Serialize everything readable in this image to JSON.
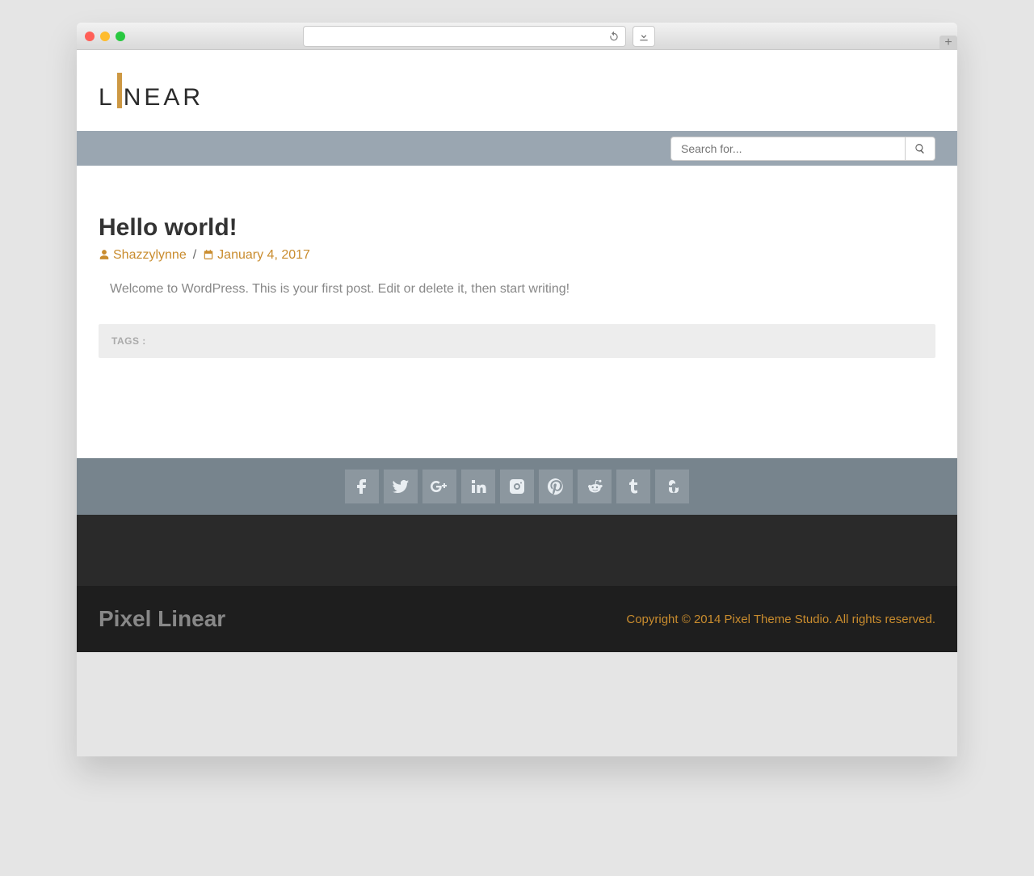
{
  "browser": {
    "address_value": "",
    "new_tab_glyph": "+"
  },
  "header": {
    "logo_left": "L",
    "logo_right": "NEAR"
  },
  "search": {
    "placeholder": "Search for..."
  },
  "post": {
    "title": "Hello world!",
    "author": "Shazzylynne",
    "date": "January 4, 2017",
    "separator": "/",
    "body": "Welcome to WordPress. This is your first post. Edit or delete it, then start writing!",
    "tags_label": "TAGS :"
  },
  "social": {
    "items": [
      "facebook",
      "twitter",
      "googleplus",
      "linkedin",
      "instagram",
      "pinterest",
      "reddit",
      "tumblr",
      "stumbleupon"
    ]
  },
  "footer": {
    "brand": "Pixel Linear",
    "copyright": "Copyright © 2014 Pixel Theme Studio. All rights reserved."
  }
}
